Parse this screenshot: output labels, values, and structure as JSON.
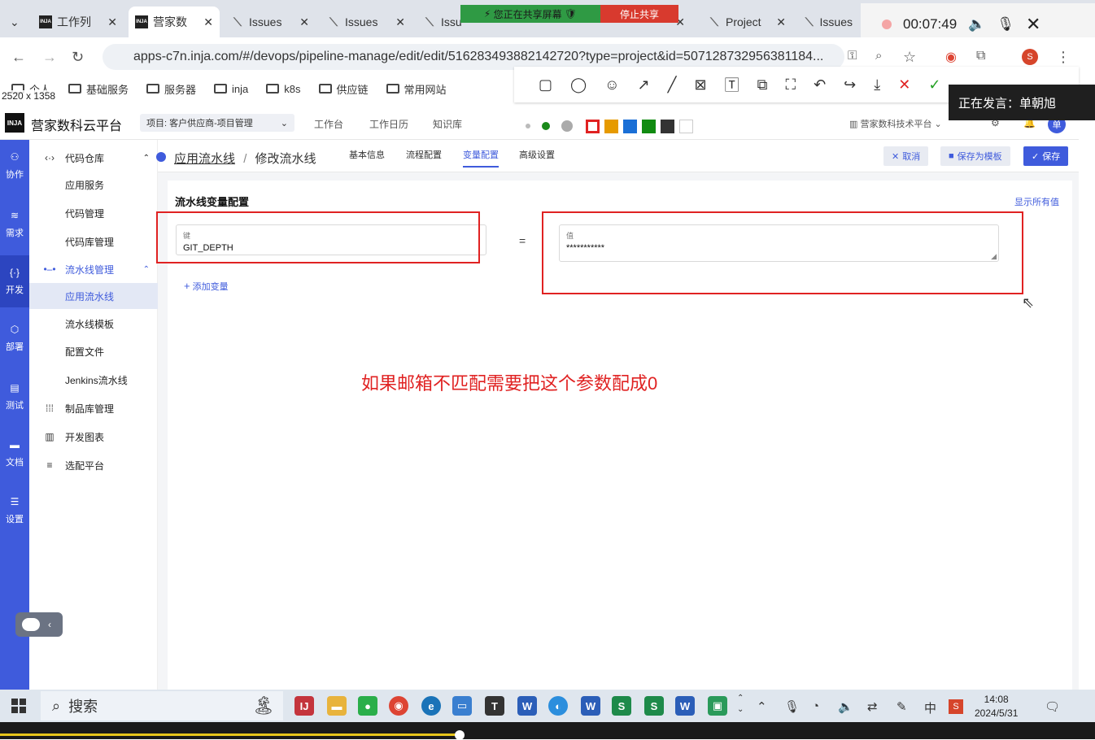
{
  "browser": {
    "tabs": [
      {
        "label": "工作列"
      },
      {
        "label": "营家数"
      },
      {
        "label": "Issues"
      },
      {
        "label": "Issues"
      },
      {
        "label": "Issu"
      },
      {
        "label": "Project"
      },
      {
        "label": "Issues"
      }
    ],
    "url": "apps-c7n.inja.com/#/devops/pipeline-manage/edit/edit/516283493882142720?type=project&id=507128732956381184...",
    "bookmarks": [
      "个人",
      "基础服务",
      "服务器",
      "inja",
      "k8s",
      "供应链",
      "常用网站"
    ],
    "screenshot_dims": "2520 x 1358"
  },
  "sharing": {
    "status": "您正在共享屏幕",
    "stop": "停止共享",
    "timer": "00:07:49",
    "speaker": "正在发言：单朝旭"
  },
  "palette_colors": [
    "#bbbbbb",
    "#1a8a1a",
    "#aaaaaa",
    "#e02222",
    "#e69a00",
    "#1a6fd6",
    "#118b11",
    "#333333",
    "#ffffff"
  ],
  "app": {
    "logo": "INJA",
    "name": "营家数科云平台",
    "project": "项目: 客户供应商-项目管理",
    "nav": [
      "工作台",
      "工作日历",
      "知识库"
    ],
    "org": "营家数科技术平台",
    "avatar": "单"
  },
  "rail": [
    {
      "label": "协作",
      "icon": "users-icon"
    },
    {
      "label": "需求",
      "icon": "layers-icon"
    },
    {
      "label": "开发",
      "icon": "code-icon"
    },
    {
      "label": "部署",
      "icon": "cube-icon"
    },
    {
      "label": "测试",
      "icon": "clipboard-icon"
    },
    {
      "label": "文档",
      "icon": "folder-icon"
    },
    {
      "label": "设置",
      "icon": "server-icon"
    }
  ],
  "menu": [
    {
      "label": "代码仓库",
      "group": true,
      "icon": "‹·›"
    },
    {
      "label": "应用服务"
    },
    {
      "label": "代码管理"
    },
    {
      "label": "代码库管理"
    },
    {
      "label": "流水线管理",
      "group": true,
      "icon": "•–•"
    },
    {
      "label": "应用流水线",
      "selected": true
    },
    {
      "label": "流水线模板"
    },
    {
      "label": "配置文件"
    },
    {
      "label": "Jenkins流水线"
    },
    {
      "label": "制品库管理",
      "group": true,
      "icon": "⁞⁞⁞"
    },
    {
      "label": "开发图表",
      "group": true,
      "icon": "▥"
    },
    {
      "label": "选配平台",
      "group": true,
      "icon": "≡"
    }
  ],
  "page": {
    "breadcrumb_parent": "应用流水线",
    "breadcrumb_sep": "/",
    "breadcrumb_current": "修改流水线",
    "tabs": [
      "基本信息",
      "流程配置",
      "变量配置",
      "高级设置"
    ],
    "active_tab": "变量配置",
    "cancel": "取消",
    "save_template": "保存为模板",
    "save": "保存",
    "section_title": "流水线变量配置",
    "show_all": "显示所有值",
    "key_label": "键",
    "key_value": "GIT_DEPTH",
    "equals": "=",
    "value_label": "值",
    "value_value": "***********",
    "add_variable": "添加变量",
    "annotation": "如果邮箱不匹配需要把这个参数配成0"
  },
  "taskbar": {
    "search": "搜索",
    "ime": "中",
    "time": "14:08",
    "date": "2024/5/31"
  },
  "video_progress": 0.42
}
